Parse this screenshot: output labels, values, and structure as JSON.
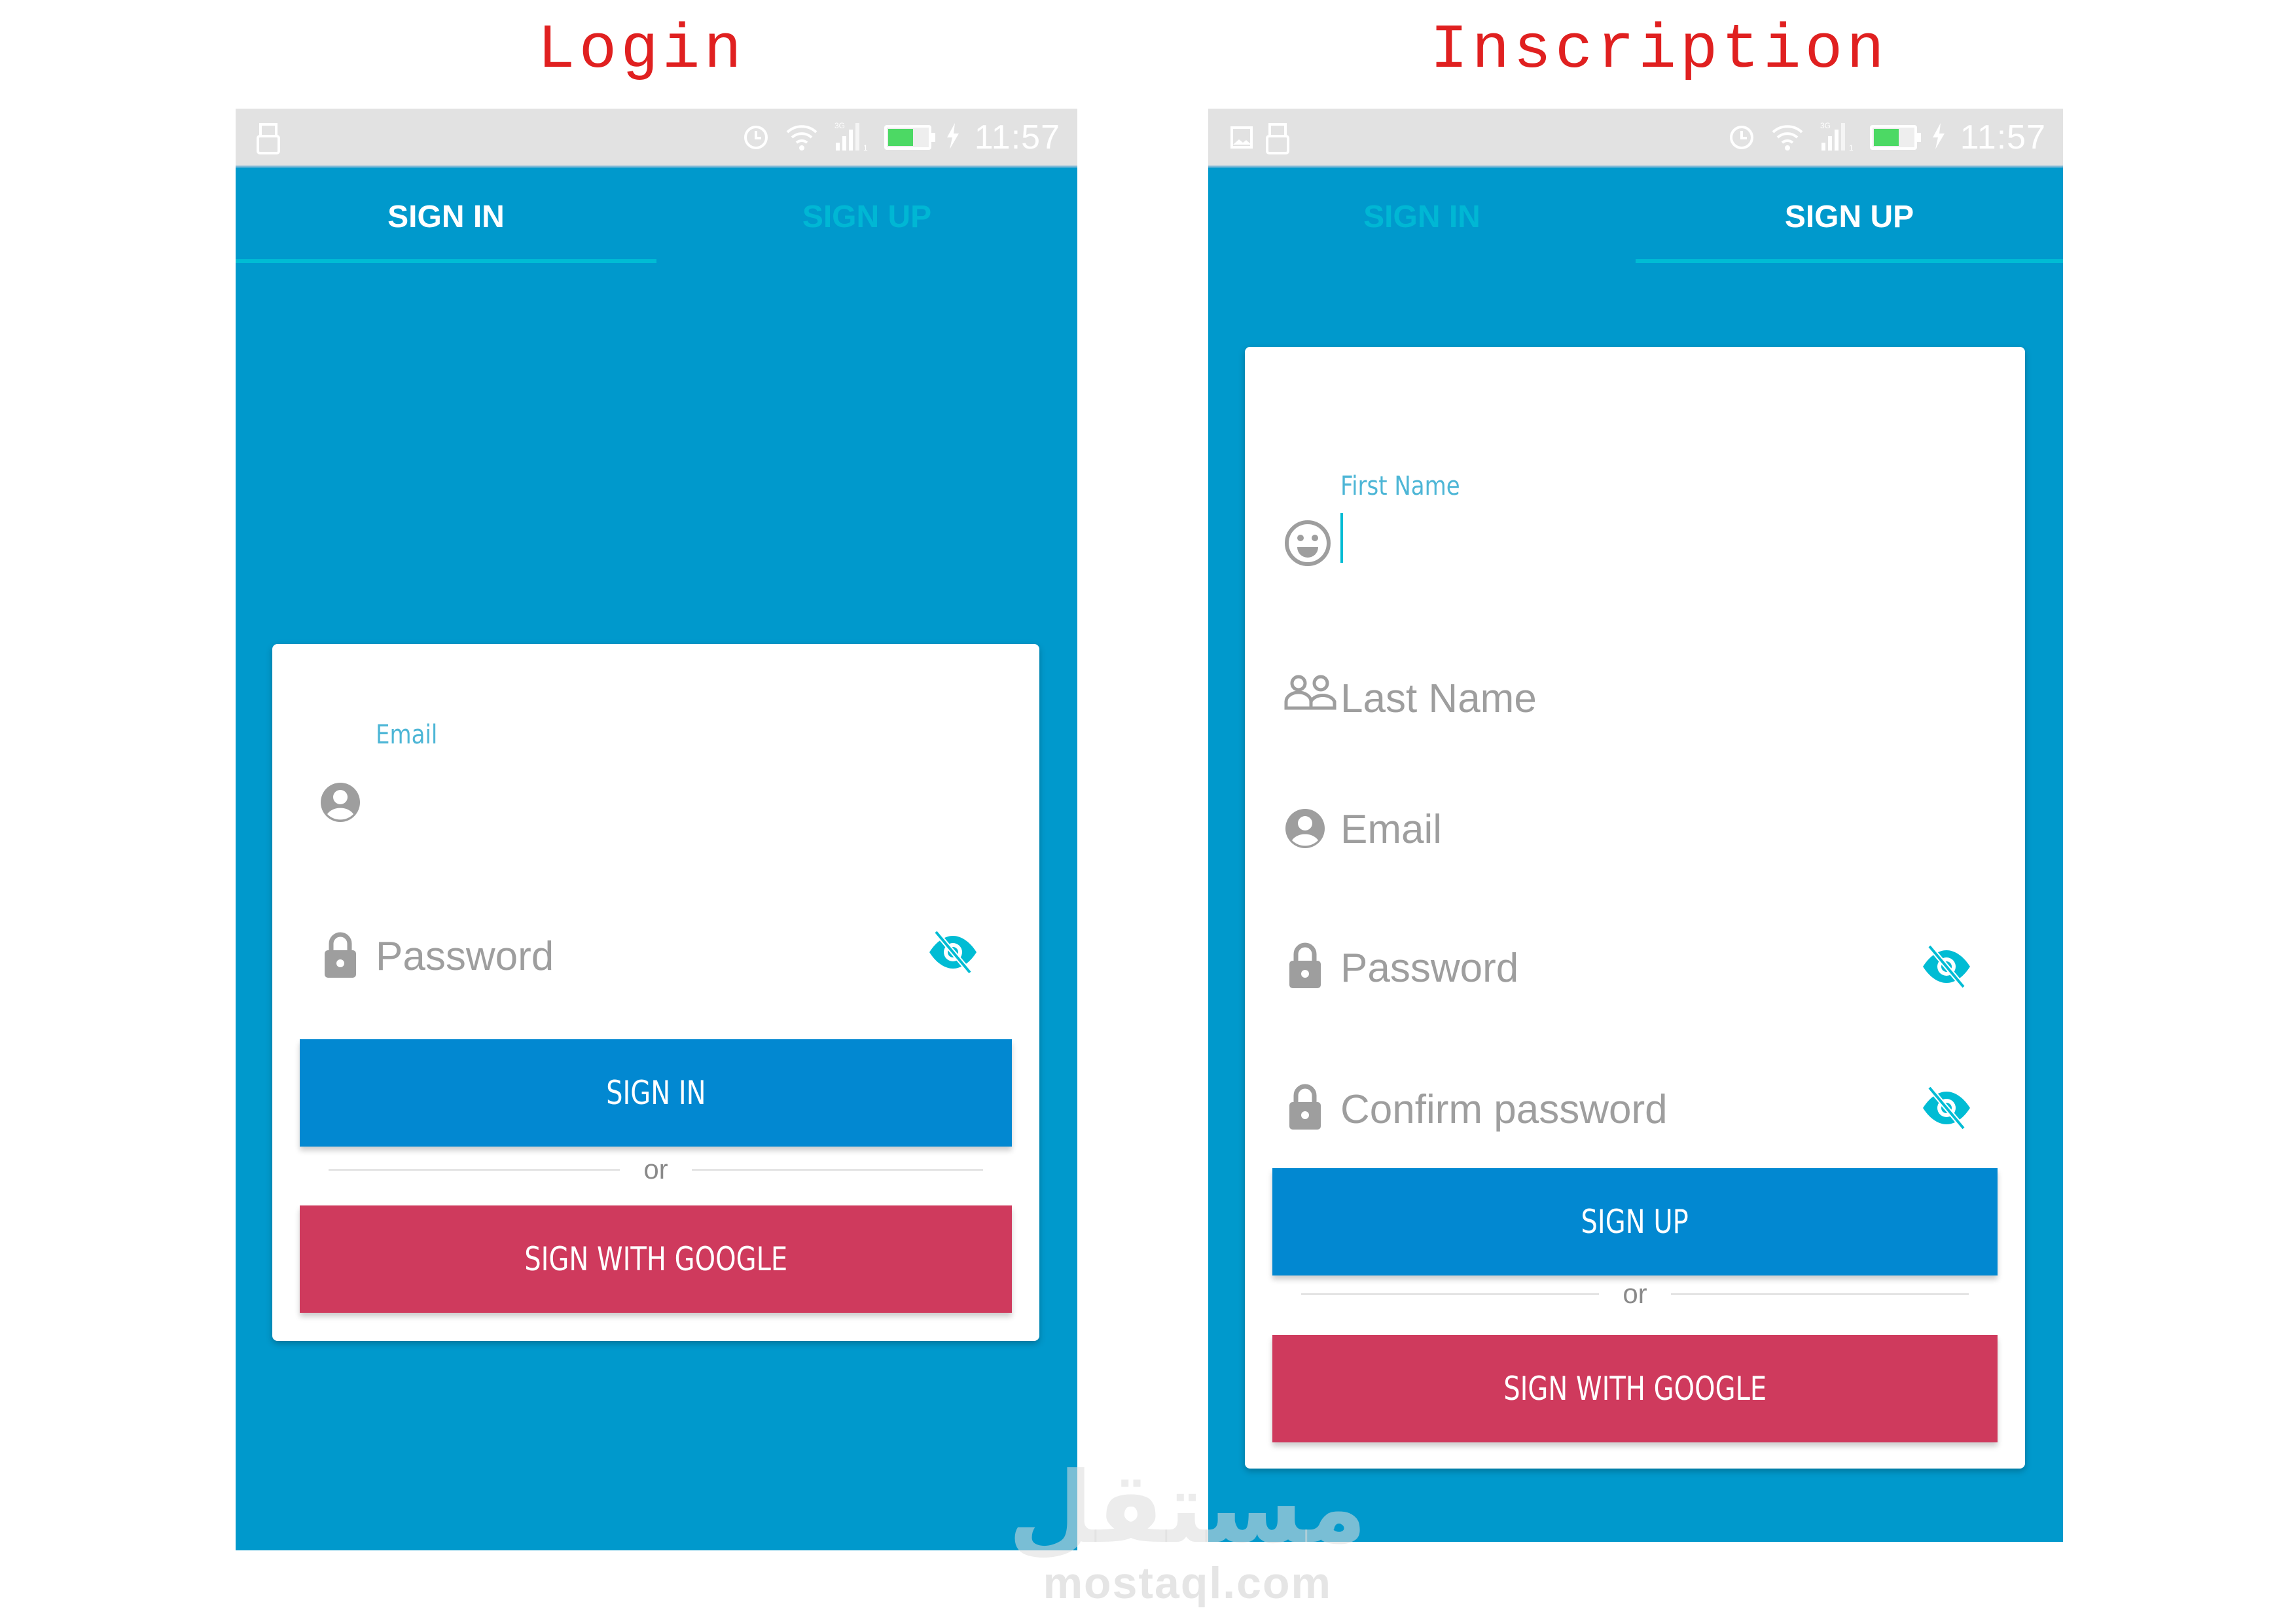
{
  "captions": {
    "login": "Login",
    "signup": "Inscription"
  },
  "status_bar": {
    "time": "11:57",
    "network": "3G",
    "sim_slot": "1",
    "battery_level": 0.6,
    "charging": true,
    "icons_left_login": [
      "usb-icon"
    ],
    "icons_left_signup": [
      "image-icon",
      "usb-icon"
    ],
    "icons_right": [
      "alarm-icon",
      "wifi-icon",
      "signal-icon",
      "battery-icon",
      "charging-icon"
    ]
  },
  "tabs": {
    "sign_in": "SIGN IN",
    "sign_up": "SIGN UP"
  },
  "login": {
    "active_tab": "SIGN IN",
    "email": {
      "label": "Email",
      "value": ""
    },
    "password": {
      "placeholder": "Password"
    },
    "sign_in_button": "SIGN IN",
    "or_text": "or",
    "google_button": "SIGN WITH GOOGLE"
  },
  "signup": {
    "active_tab": "SIGN UP",
    "first_name": {
      "label": "First Name",
      "value": ""
    },
    "last_name": {
      "placeholder": "Last Name"
    },
    "email": {
      "placeholder": "Email"
    },
    "password": {
      "placeholder": "Password"
    },
    "confirm_password": {
      "placeholder": "Confirm password"
    },
    "sign_up_button": "SIGN UP",
    "or_text": "or",
    "google_button": "SIGN WITH GOOGLE"
  },
  "colors": {
    "app_background": "#0099cc",
    "tab_indicator": "#00bcd4",
    "primary_button": "#0288d1",
    "google_button": "#cf3a5d",
    "caption": "#e02020",
    "accent": "#00bcd4"
  },
  "watermark": {
    "arabic": "مستقل",
    "latin": "mostaql.com"
  }
}
